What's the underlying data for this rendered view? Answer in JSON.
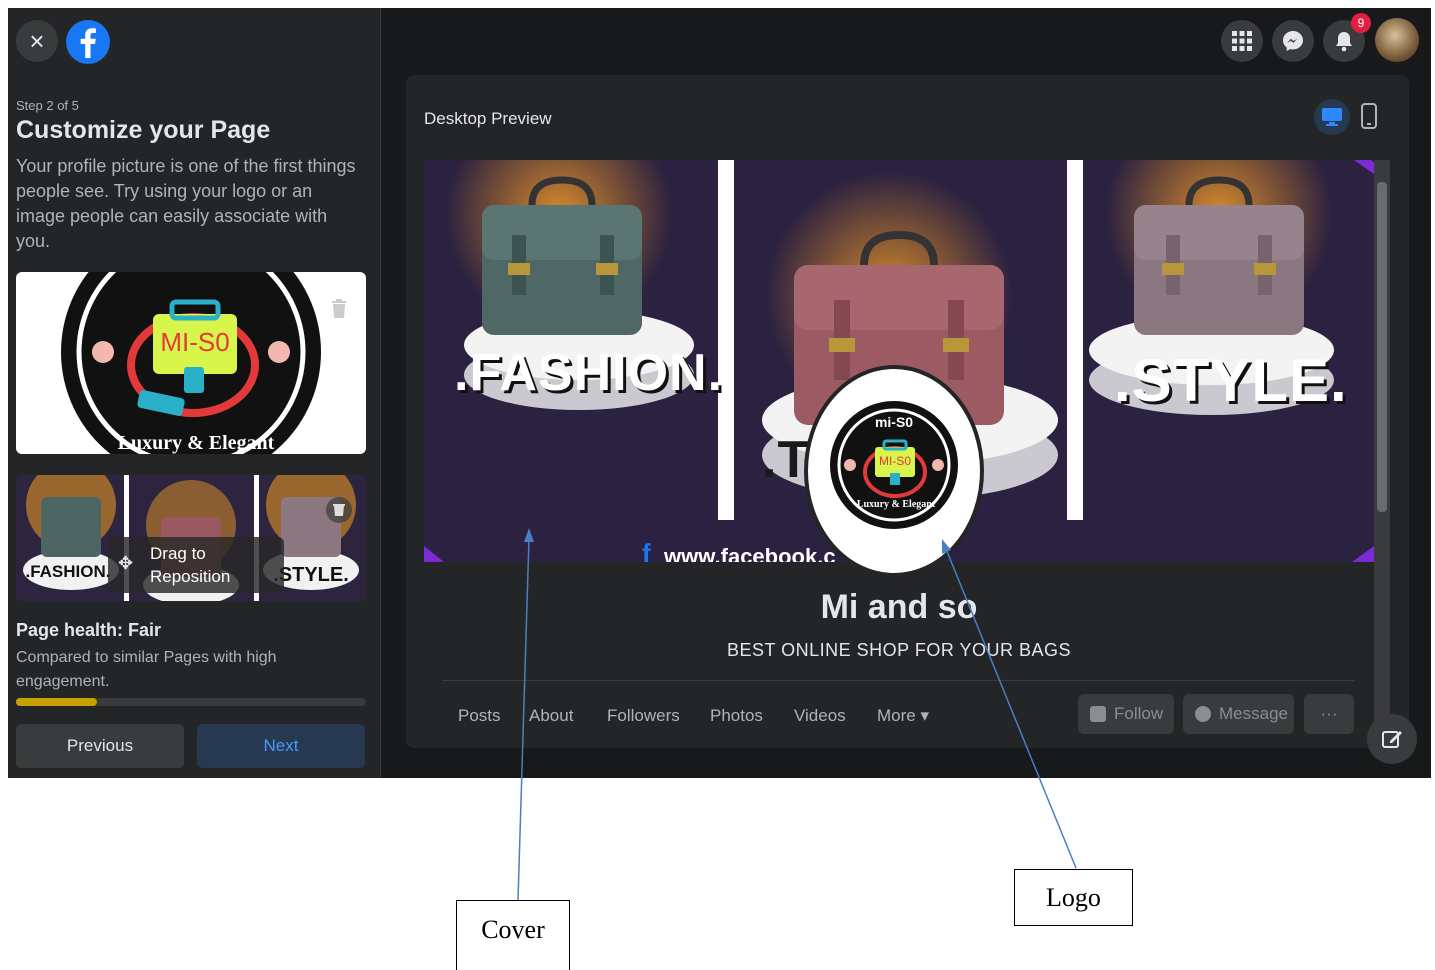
{
  "left_panel": {
    "step": "Step 2 of 5",
    "title": "Customize your Page",
    "description": "Your profile picture is one of the first things people see. Try using your logo or an image people can easily associate with you.",
    "logo_text": {
      "top": "mi-S0",
      "center": "MI-S0",
      "bottom": "Luxury & Elegant"
    },
    "drag_tip": {
      "line1": "Drag to",
      "line2": "Reposition"
    },
    "health_title": "Page health: Fair",
    "health_sub": "Compared to similar Pages with high engagement.",
    "health_progress": 0.23,
    "previous_label": "Previous",
    "next_label": "Next"
  },
  "top_bar": {
    "notification_count": "9"
  },
  "preview": {
    "label": "Desktop Preview",
    "cover_words": {
      "left": ".FASHION.",
      "center": ".TREND.",
      "right": ".STYLE."
    },
    "cover_url": "www.facebook.c",
    "page_name": "Mi and so",
    "page_subtitle": "BEST ONLINE SHOP FOR YOUR BAGS",
    "tabs": [
      "Posts",
      "About",
      "Followers",
      "Photos",
      "Videos",
      "More ▾"
    ],
    "actions": {
      "follow": "Follow",
      "message": "Message",
      "more": "···"
    }
  },
  "annotations": {
    "cover": "Cover",
    "logo": "Logo"
  },
  "colors": {
    "accent": "#1877f2",
    "health_bar": "#c6a100",
    "cover_bg": "#2b2140"
  }
}
